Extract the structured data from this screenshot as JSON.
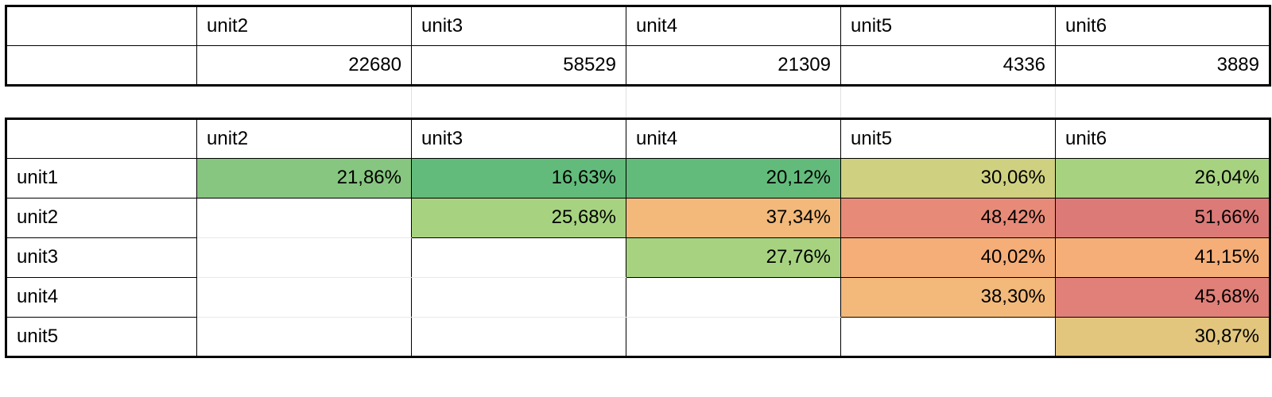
{
  "top_table": {
    "row_label": "",
    "headers": [
      "unit2",
      "unit3",
      "unit4",
      "unit5",
      "unit6"
    ],
    "values": [
      "22680",
      "58529",
      "21309",
      "4336",
      "3889"
    ]
  },
  "matrix": {
    "col_headers": [
      "unit2",
      "unit3",
      "unit4",
      "unit5",
      "unit6"
    ],
    "row_headers": [
      "unit1",
      "unit2",
      "unit3",
      "unit4",
      "unit5"
    ],
    "rows": [
      {
        "label": "unit1",
        "cells": [
          "21,86%",
          "16,63%",
          "20,12%",
          "30,06%",
          "26,04%"
        ]
      },
      {
        "label": "unit2",
        "cells": [
          "",
          "25,68%",
          "37,34%",
          "48,42%",
          "51,66%"
        ]
      },
      {
        "label": "unit3",
        "cells": [
          "",
          "",
          "27,76%",
          "40,02%",
          "41,15%"
        ]
      },
      {
        "label": "unit4",
        "cells": [
          "",
          "",
          "",
          "38,30%",
          "45,68%"
        ]
      },
      {
        "label": "unit5",
        "cells": [
          "",
          "",
          "",
          "",
          "30,87%"
        ]
      }
    ]
  },
  "chart_data": {
    "type": "heatmap",
    "title": "",
    "xlabel": "",
    "ylabel": "",
    "x_categories": [
      "unit2",
      "unit3",
      "unit4",
      "unit5",
      "unit6"
    ],
    "y_categories": [
      "unit1",
      "unit2",
      "unit3",
      "unit4",
      "unit5"
    ],
    "values": [
      [
        21.86,
        16.63,
        20.12,
        30.06,
        26.04
      ],
      [
        null,
        25.68,
        37.34,
        48.42,
        51.66
      ],
      [
        null,
        null,
        27.76,
        40.02,
        41.15
      ],
      [
        null,
        null,
        null,
        38.3,
        45.68
      ],
      [
        null,
        null,
        null,
        null,
        30.87
      ]
    ],
    "color_scale": {
      "low": 16.63,
      "high": 51.66,
      "low_color": "#63bb7b",
      "high_color": "#dc7a78"
    },
    "column_totals": {
      "unit2": 22680,
      "unit3": 58529,
      "unit4": 21309,
      "unit5": 4336,
      "unit6": 3889
    }
  }
}
